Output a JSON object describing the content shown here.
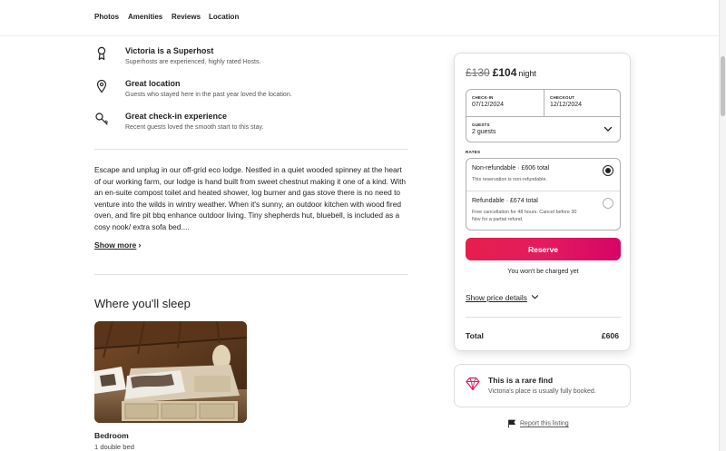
{
  "nav": {
    "tabs": [
      "Photos",
      "Amenities",
      "Reviews",
      "Location"
    ]
  },
  "highlights": [
    {
      "icon": "superhost-medal-icon",
      "title": "Victoria is a Superhost",
      "subtitle": "Superhosts are experienced, highly rated Hosts."
    },
    {
      "icon": "location-pin-icon",
      "title": "Great location",
      "subtitle": "Guests who stayed here in the past year loved the location."
    },
    {
      "icon": "key-icon",
      "title": "Great check-in experience",
      "subtitle": "Recent guests loved the smooth start to this stay."
    }
  ],
  "description": {
    "text": "Escape and unplug in our off-grid eco lodge. Nestled in a quiet wooded spinney at the heart of our working farm, our lodge is hand built from sweet chestnut making it one of a kind. With an en-suite compost toilet and heated shower, log burner and gas stove there is no need to venture into the wilds in wintry weather. When it's sunny, an outdoor kitchen with wood fired oven, and fire pit bbq enhance outdoor living. Tiny shepherds hut, bluebell, is included as a cosy nook/ extra sofa bed....",
    "show_more": "Show more"
  },
  "sleep": {
    "title": "Where you'll sleep",
    "room": {
      "name": "Bedroom",
      "beds": "1 double bed"
    }
  },
  "booking": {
    "old_price": "£130",
    "new_price": "£104",
    "per": "night",
    "checkin_label": "CHECK-IN",
    "checkin": "07/12/2024",
    "checkout_label": "CHECKOUT",
    "checkout": "12/12/2024",
    "guests_label": "GUESTS",
    "guests": "2 guests",
    "rates_label": "RATES",
    "rates": [
      {
        "title": "Non-refundable · £606 total",
        "sub": "This reservation is non-refundable.",
        "selected": true
      },
      {
        "title": "Refundable · £674 total",
        "sub": "Free cancellation for 48 hours. Cancel before 30 Nov for a partial refund.",
        "selected": false
      }
    ],
    "reserve": "Reserve",
    "note": "You won't be charged yet",
    "price_details": "Show price details",
    "total_label": "Total",
    "total": "£606",
    "accent": "#e31c5f"
  },
  "rare_find": {
    "title": "This is a rare find",
    "subtitle": "Victoria's place is usually fully booked."
  },
  "report": "Report this listing"
}
